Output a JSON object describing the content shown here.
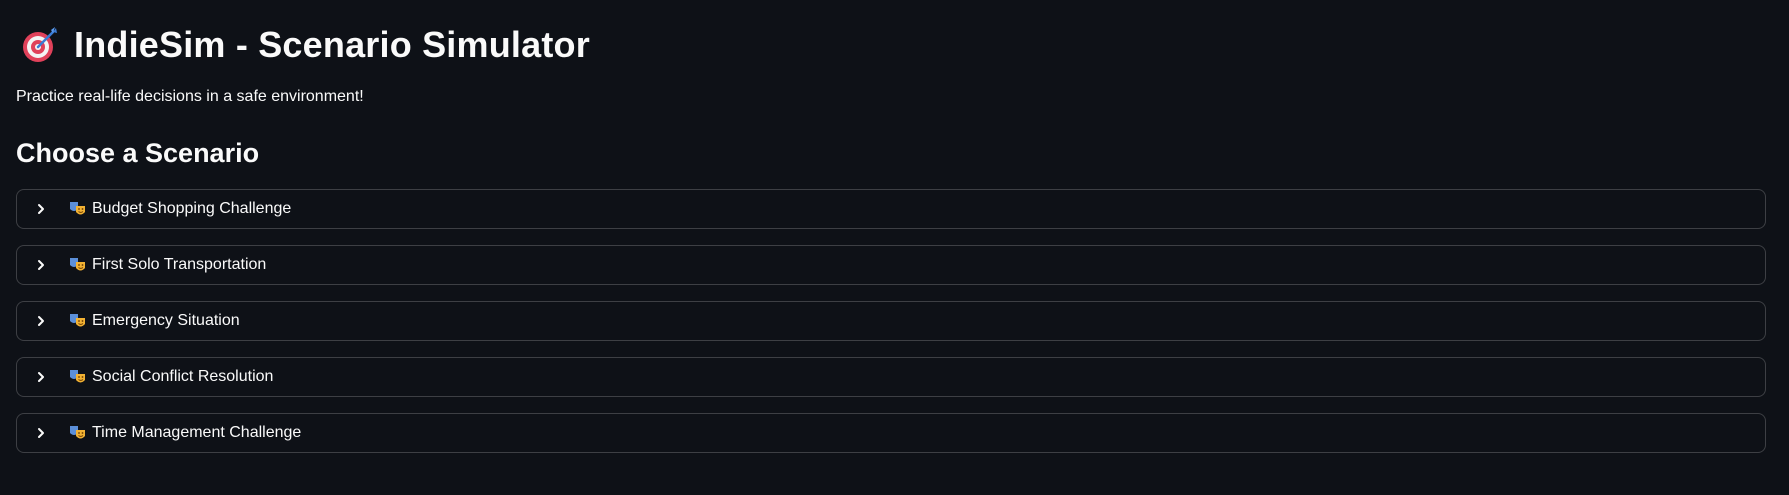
{
  "header": {
    "title": "IndieSim - Scenario Simulator",
    "title_icon": "target-icon",
    "subtitle": "Practice real-life decisions in a safe environment!"
  },
  "section": {
    "heading": "Choose a Scenario"
  },
  "scenarios": [
    {
      "label": "Budget Shopping Challenge",
      "icon": "theater-masks-icon"
    },
    {
      "label": "First Solo Transportation",
      "icon": "theater-masks-icon"
    },
    {
      "label": "Emergency Situation",
      "icon": "theater-masks-icon"
    },
    {
      "label": "Social Conflict Resolution",
      "icon": "theater-masks-icon"
    },
    {
      "label": "Time Management Challenge",
      "icon": "theater-masks-icon"
    }
  ],
  "colors": {
    "background": "#0e1117",
    "text": "#fafafa",
    "border": "rgba(250,250,250,0.2)"
  }
}
